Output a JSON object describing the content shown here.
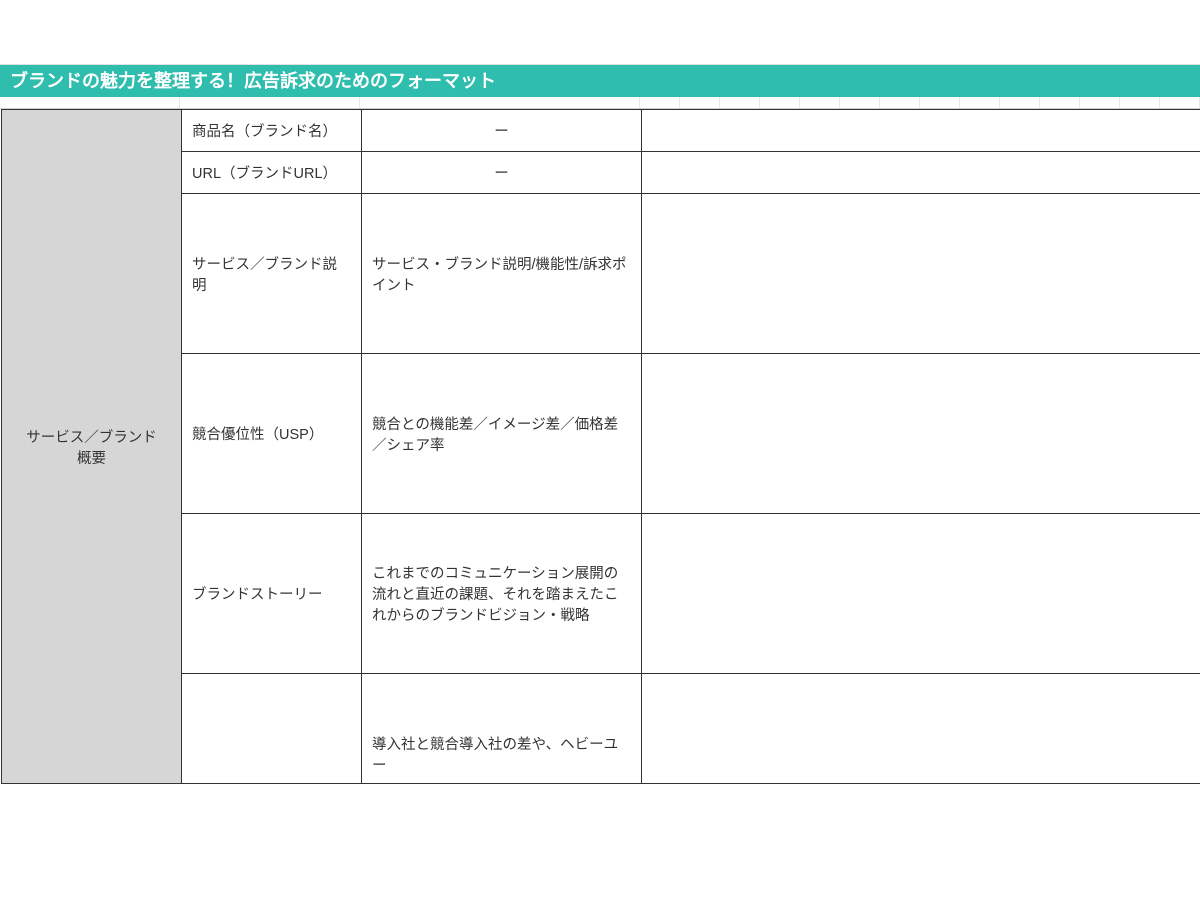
{
  "title": "ブランドの魅力を整理する！広告訴求のためのフォーマット",
  "category": "サービス／ブランド\n概要",
  "rows": [
    {
      "label": "商品名（ブランド名）",
      "desc": "ー",
      "desc_centered": true,
      "height": "short"
    },
    {
      "label": "URL（ブランドURL）",
      "desc": "ー",
      "desc_centered": true,
      "height": "short"
    },
    {
      "label": "サービス／ブランド説明",
      "desc": "サービス・ブランド説明/機能性/訴求ポイント",
      "desc_centered": false,
      "height": "tall"
    },
    {
      "label": "競合優位性（USP）",
      "desc": "競合との機能差／イメージ差／価格差／シェア率",
      "desc_centered": false,
      "height": "tall"
    },
    {
      "label": "ブランドストーリー",
      "desc": "これまでのコミュニケーション展開の流れと直近の課題、それを踏まえたこれからのブランドビジョン・戦略",
      "desc_centered": false,
      "height": "tall"
    },
    {
      "label": "",
      "desc": "導入社と競合導入社の差や、ヘビーユー",
      "desc_centered": false,
      "height": "partial"
    }
  ],
  "ruler_widths": [
    180,
    180,
    280,
    40,
    40,
    40,
    40,
    40,
    40,
    40,
    40,
    40,
    40,
    40,
    40,
    40,
    40
  ]
}
